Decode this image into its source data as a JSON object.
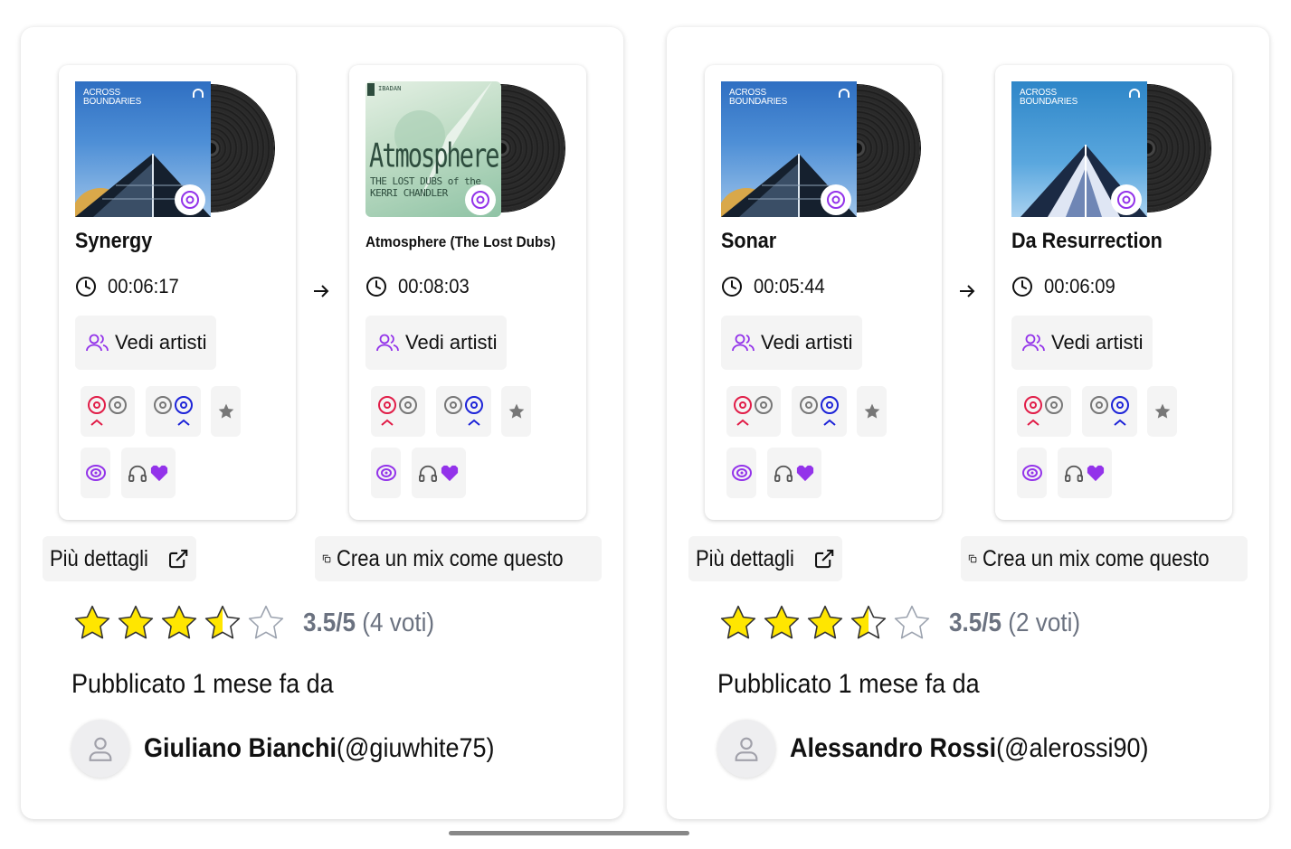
{
  "mixes": [
    {
      "tracks": [
        {
          "title": "Synergy",
          "duration": "00:06:17",
          "artists_label": "Vedi artisti",
          "cover_text": "ACROSS BOUNDARIES"
        },
        {
          "title": "Atmosphere (The Lost Dubs)",
          "duration": "00:08:03",
          "artists_label": "Vedi artisti",
          "cover_text": "Atmosphere",
          "cover_subtext": "THE LOST DUBS of the KERRI CHANDLER"
        }
      ],
      "details_label": "Più dettagli",
      "mix_label": "Crea un mix come questo",
      "rating_score": "3.5/5",
      "rating_votes": "(4 voti)",
      "rating_value": 3.5,
      "published": "Pubblicato 1 mese fa da",
      "author_name": "Giuliano Bianchi",
      "author_handle": "(@giuwhite75)"
    },
    {
      "tracks": [
        {
          "title": "Sonar",
          "duration": "00:05:44",
          "artists_label": "Vedi artisti",
          "cover_text": "ACROSS BOUNDARIES"
        },
        {
          "title": "Da Resurrection",
          "duration": "00:06:09",
          "artists_label": "Vedi artisti",
          "cover_text": "ACROSS BOUNDARIES"
        }
      ],
      "details_label": "Più dettagli",
      "mix_label": "Crea un mix come questo",
      "rating_score": "3.5/5",
      "rating_votes": "(2 voti)",
      "rating_value": 3.5,
      "published": "Pubblicato 1 mese fa da",
      "author_name": "Alessandro Rossi",
      "author_handle": "(@alerossi90)"
    }
  ],
  "colors": {
    "accent": "#9333ea",
    "star": "#ffe600",
    "muted": "#6b7280",
    "chip_bg": "#f4f4f4"
  }
}
